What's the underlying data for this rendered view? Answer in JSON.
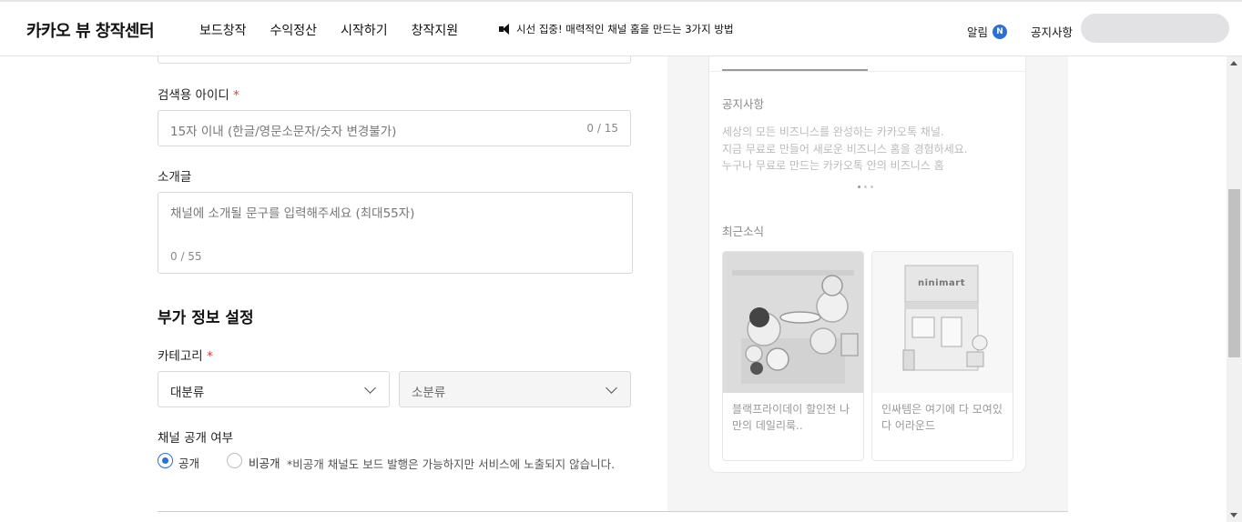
{
  "header": {
    "logo": "카카오 뷰 창작센터",
    "nav": [
      "보드창작",
      "수익정산",
      "시작하기",
      "창작지원"
    ],
    "notice_banner": "시선 집중! 매력적인 채널 홈을 만드는 3가지 방법",
    "alarm_label": "알림",
    "alarm_badge": "N",
    "notice_link": "공지사항"
  },
  "form": {
    "search_id": {
      "label": "검색용 아이디",
      "required_mark": "*",
      "placeholder": "15자 이내 (한글/영문소문자/숫자 변경불가)",
      "counter": "0 / 15"
    },
    "intro": {
      "label": "소개글",
      "placeholder": "채널에 소개될 문구를 입력해주세요 (최대55자)",
      "counter": "0 / 55"
    },
    "extra_section_title": "부가 정보 설정",
    "category": {
      "label": "카테고리",
      "required_mark": "*",
      "major": "대분류",
      "minor": "소분류"
    },
    "visibility": {
      "label": "채널 공개 여부",
      "public": "공개",
      "private": "비공개",
      "note": "*비공개 채널도 보드 발행은 가능하지만 서비스에 노출되지 않습니다.",
      "selected": "public"
    }
  },
  "preview": {
    "notice_heading": "공지사항",
    "notice_lines": [
      "세상의 모든 비즈니스를 완성하는 카카오톡 채널.",
      "지금 무료로 만들어 새로운 비즈니스 홈을 경험하세요.",
      "누구나 무료로 만드는 카카오톡 안의 비즈니스 홈"
    ],
    "news_heading": "최근소식",
    "news": [
      {
        "caption": "블랙프라이데이 할인전 나만의 데일리룩..",
        "image": "character-cafe-illustration"
      },
      {
        "caption": "인싸템은 여기에 다 모여있다 어라운드",
        "image": "ninimart-store-illustration",
        "sign": "ninimart"
      }
    ]
  }
}
